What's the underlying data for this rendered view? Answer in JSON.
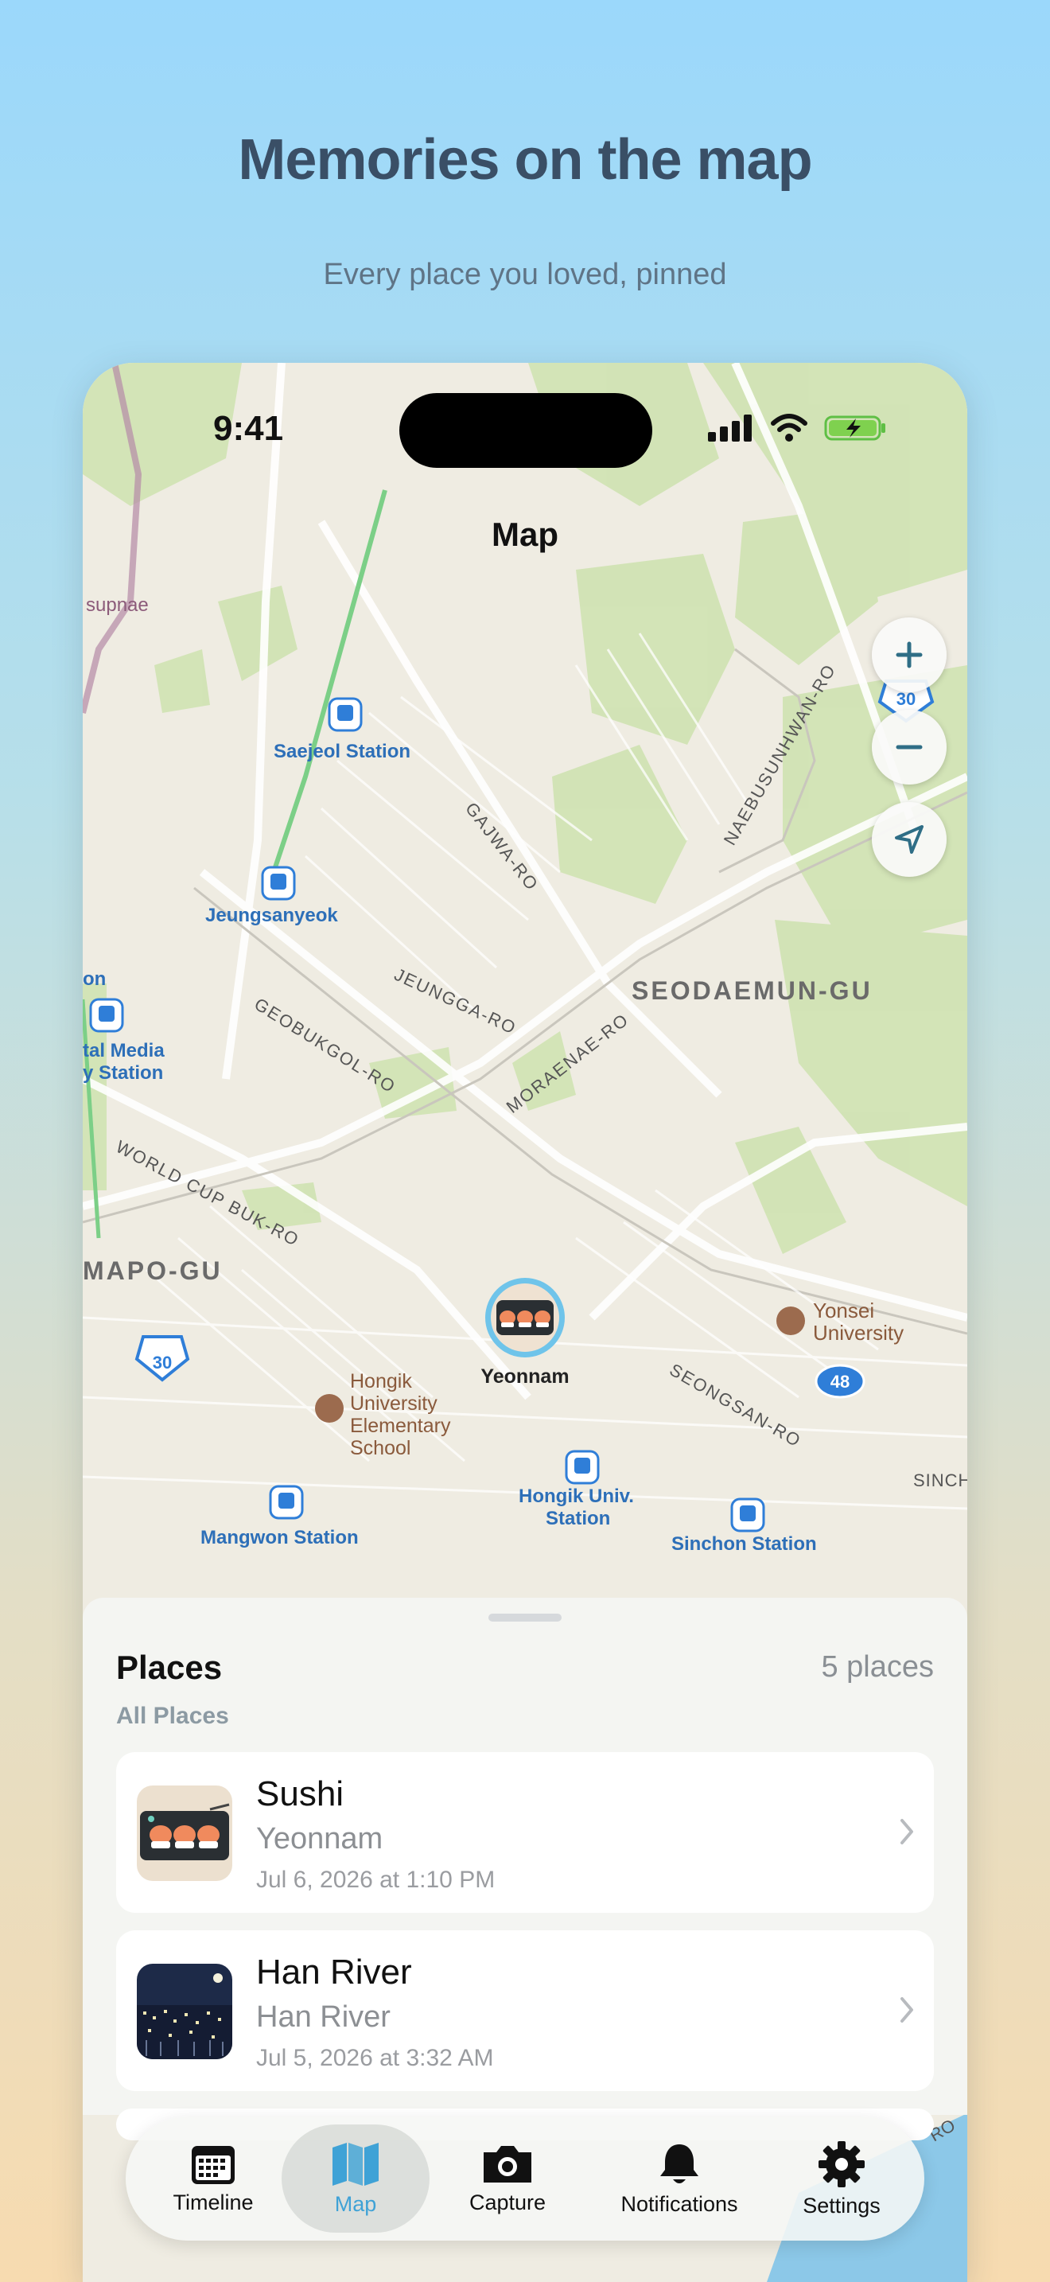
{
  "hero": {
    "title": "Memories on the map",
    "subtitle": "Every place you loved, pinned"
  },
  "status_bar": {
    "time": "9:41"
  },
  "map": {
    "title": "Map",
    "labels": {
      "supnae": "supnae",
      "saejeol": "Saejeol Station",
      "jeungsan": "Jeungsanyeok",
      "gajwa": "GAJWA-RO",
      "naebu": "NAEBUSUNHWAN-RO",
      "seodaemun": "SEODAEMUN-GU",
      "jeungga": "JEUNGGA-RO",
      "geobuk": "GEOBUKGOL-RO",
      "moraenae": "MORAENAE-RO",
      "on": "on",
      "media1": "tal Media",
      "media2": "y Station",
      "worldcup": "WORLD CUP BUK-RO",
      "mapo": "MAPO-GU",
      "yonsei1": "Yonsei",
      "yonsei2": "University",
      "hongikel1": "Hongik",
      "hongikel2": "University",
      "hongikel3": "Elementary",
      "hongikel4": "School",
      "seongsan": "SEONGSAN-RO",
      "hongikuniv1": "Hongik Univ.",
      "hongikuniv2": "Station",
      "mangwon": "Mangwon Station",
      "sinchon": "Sinchon Station",
      "sinch": "SINCH",
      "route30": "30",
      "route30b": "30",
      "route48": "48",
      "ro": "RO",
      "pin_label": "Yeonnam"
    },
    "zoom_in_icon": "plus-icon",
    "zoom_out_icon": "minus-icon",
    "locate_icon": "location-arrow-icon"
  },
  "sheet": {
    "title": "Places",
    "count": "5 places",
    "filter": "All Places",
    "items": [
      {
        "title": "Sushi",
        "subtitle": "Yeonnam",
        "date": "Jul 6, 2026 at 1:10 PM",
        "thumb": "sushi-thumb"
      },
      {
        "title": "Han River",
        "subtitle": "Han River",
        "date": "Jul 5, 2026 at 3:32 AM",
        "thumb": "night-city-thumb"
      }
    ]
  },
  "tabbar": {
    "tabs": [
      {
        "label": "Timeline",
        "icon": "calendar-icon"
      },
      {
        "label": "Map",
        "icon": "map-icon",
        "active": true
      },
      {
        "label": "Capture",
        "icon": "camera-icon"
      },
      {
        "label": "Notifications",
        "icon": "bell-icon"
      },
      {
        "label": "Settings",
        "icon": "gear-icon"
      }
    ]
  },
  "colors": {
    "accent": "#3fa2d6",
    "title": "#3a4f66",
    "transit_blue": "#2f7ed8",
    "label_blue": "#2d6fb8"
  }
}
